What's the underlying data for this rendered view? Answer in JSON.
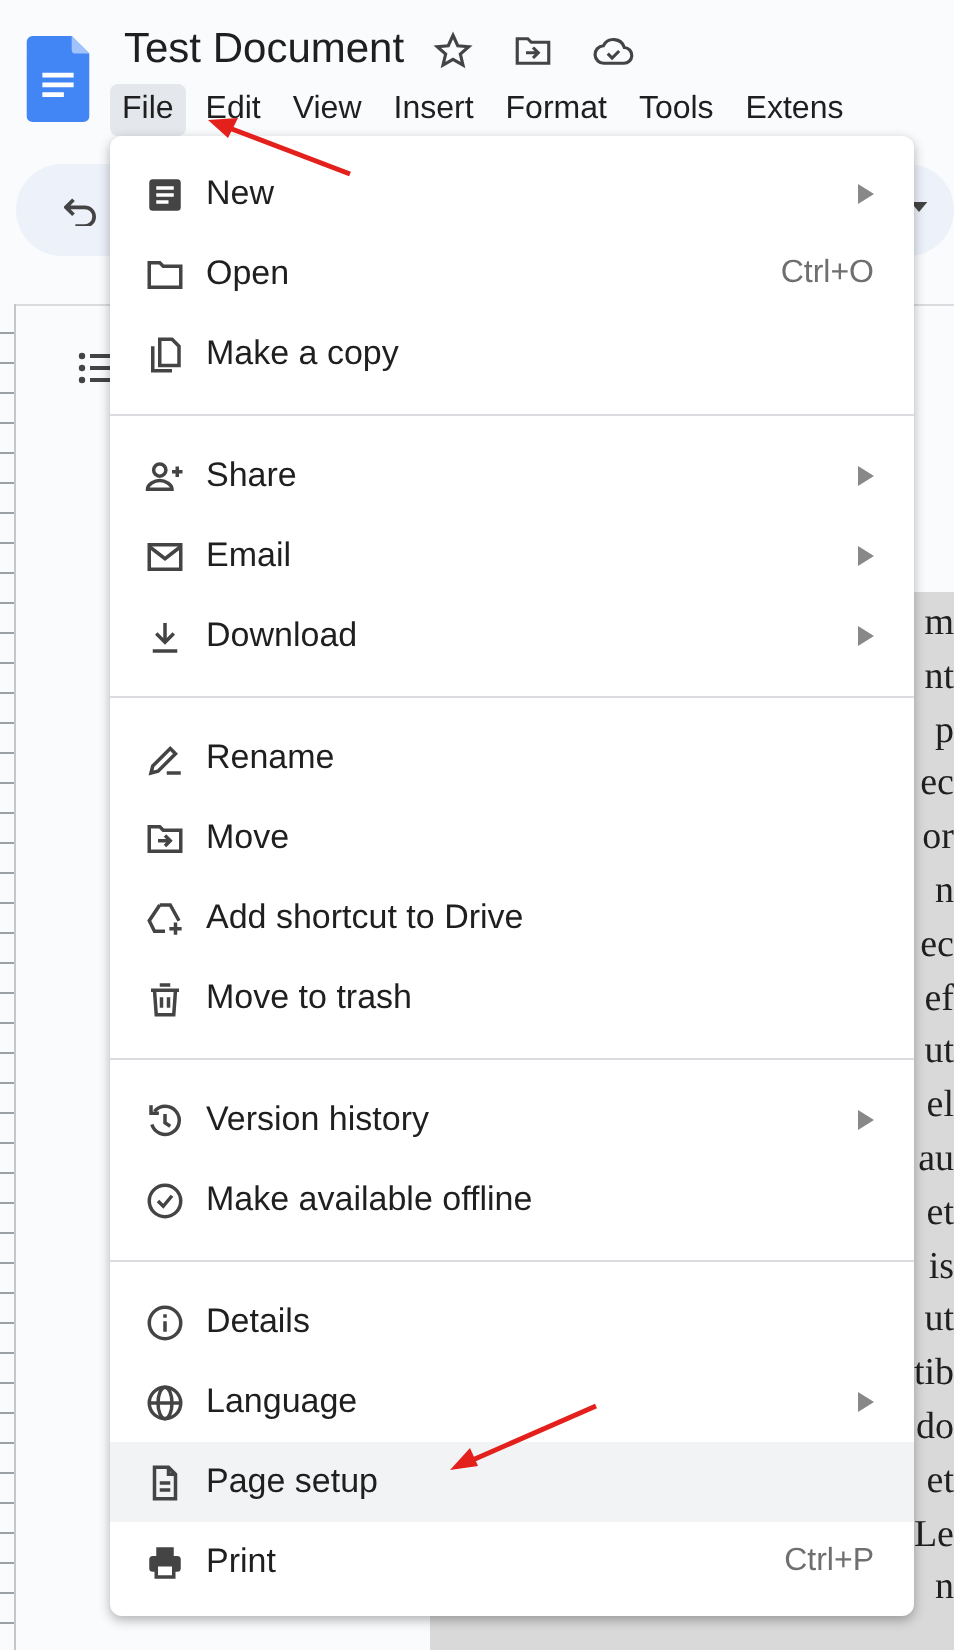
{
  "header": {
    "title": "Test Document"
  },
  "menubar": [
    {
      "label": "File",
      "selected": true
    },
    {
      "label": "Edit",
      "selected": false
    },
    {
      "label": "View",
      "selected": false
    },
    {
      "label": "Insert",
      "selected": false
    },
    {
      "label": "Format",
      "selected": false
    },
    {
      "label": "Tools",
      "selected": false
    },
    {
      "label": "Extens",
      "selected": false
    }
  ],
  "file_menu": {
    "sections": [
      {
        "items": [
          {
            "label": "New",
            "submenu": true,
            "selected": false
          },
          {
            "label": "Open",
            "shortcut": "Ctrl+O",
            "submenu": false,
            "selected": false
          },
          {
            "label": "Make a copy",
            "submenu": false,
            "selected": false
          }
        ]
      },
      {
        "items": [
          {
            "label": "Share",
            "submenu": true,
            "selected": false
          },
          {
            "label": "Email",
            "submenu": true,
            "selected": false
          },
          {
            "label": "Download",
            "submenu": true,
            "selected": false
          }
        ]
      },
      {
        "items": [
          {
            "label": "Rename",
            "submenu": false,
            "selected": false
          },
          {
            "label": "Move",
            "submenu": false,
            "selected": false
          },
          {
            "label": "Add shortcut to Drive",
            "submenu": false,
            "selected": false
          },
          {
            "label": "Move to trash",
            "submenu": false,
            "selected": false
          }
        ]
      },
      {
        "items": [
          {
            "label": "Version history",
            "submenu": true,
            "selected": false
          },
          {
            "label": "Make available offline",
            "submenu": false,
            "selected": false
          }
        ]
      },
      {
        "items": [
          {
            "label": "Details",
            "submenu": false,
            "selected": false
          },
          {
            "label": "Language",
            "submenu": true,
            "selected": false
          },
          {
            "label": "Page setup",
            "submenu": false,
            "selected": true
          },
          {
            "label": "Print",
            "shortcut": "Ctrl+P",
            "submenu": false,
            "selected": false
          }
        ]
      }
    ]
  },
  "document": {
    "selected": true,
    "lines": [
      "m",
      "nt",
      "p",
      "ec",
      "or",
      "n",
      "ec",
      "ef",
      "ut",
      "el",
      "au",
      "et",
      "is",
      "ut",
      "tib",
      "do",
      "et",
      "Le",
      "n"
    ]
  }
}
